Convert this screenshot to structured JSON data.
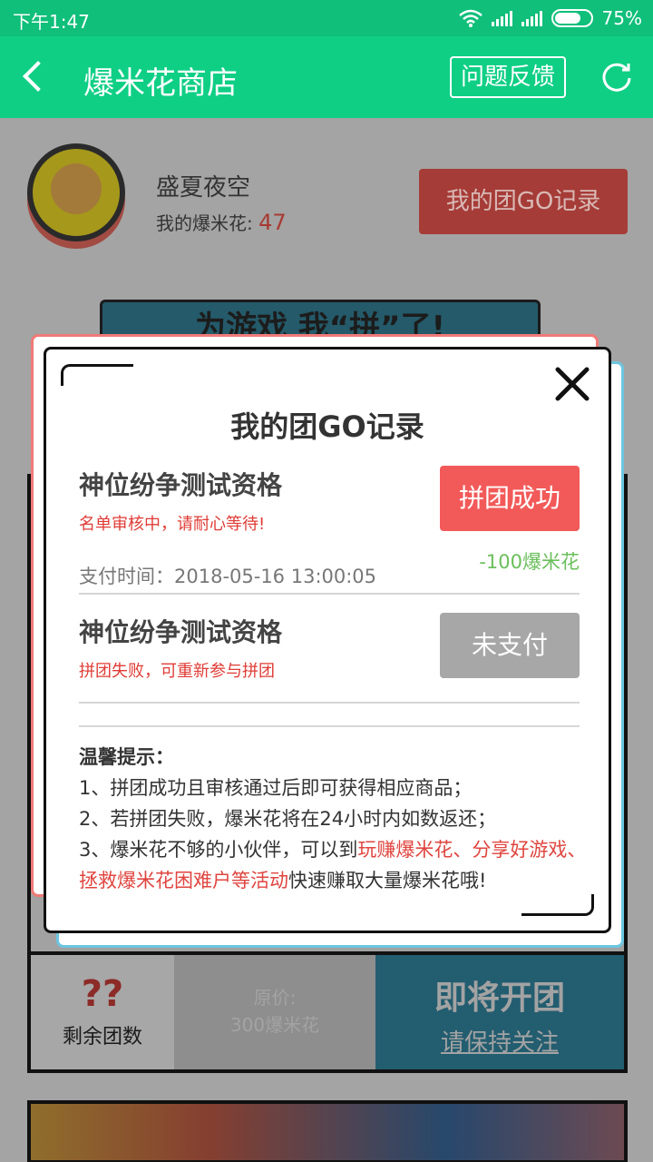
{
  "status_bar": {
    "time": "下午1:47",
    "battery": "75%"
  },
  "header": {
    "title": "爆米花商店",
    "feedback_label": "问题反馈"
  },
  "profile": {
    "username": "盛夏夜空",
    "points_label": "我的爆米花:",
    "points_value": "47",
    "records_button": "我的团GO记录"
  },
  "banner": {
    "text": "为游戏 我“拼”了!"
  },
  "card": {
    "remaining_value": "??",
    "remaining_label": "剩余团数",
    "original_price_label": "原价:",
    "original_price_value": "300爆米花",
    "soon_label": "即将开团",
    "follow_label": "请保持关注"
  },
  "modal": {
    "title": "我的团GO记录",
    "records": [
      {
        "name": "神位纷争测试资格",
        "note": "名单审核中，请耐心等待!",
        "status": "拼团成功",
        "status_color": "#f25a59",
        "pay_time": "支付时间：2018-05-16 13:00:05",
        "cost": "-100爆米花"
      },
      {
        "name": "神位纷争测试资格",
        "note": "拼团失败，可重新参与拼团",
        "status": "未支付",
        "status_color": "#a7a7a7"
      }
    ],
    "tips": {
      "heading": "温馨提示：",
      "line1": "1、拼团成功且审核通过后即可获得相应商品；",
      "line2": "2、若拼团失败，爆米花将在24小时内如数返还；",
      "line3_a": "3、爆米花不够的小伙伴，可以到",
      "line3_highlight": "玩赚爆米花、分享好游戏、拯救爆米花困难户等活动",
      "line3_b": "快速赚取大量爆米花哦!"
    }
  },
  "colors": {
    "primary_green": "#0fcf85",
    "accent_red": "#f25a59",
    "gain_green": "#6abf5b"
  }
}
